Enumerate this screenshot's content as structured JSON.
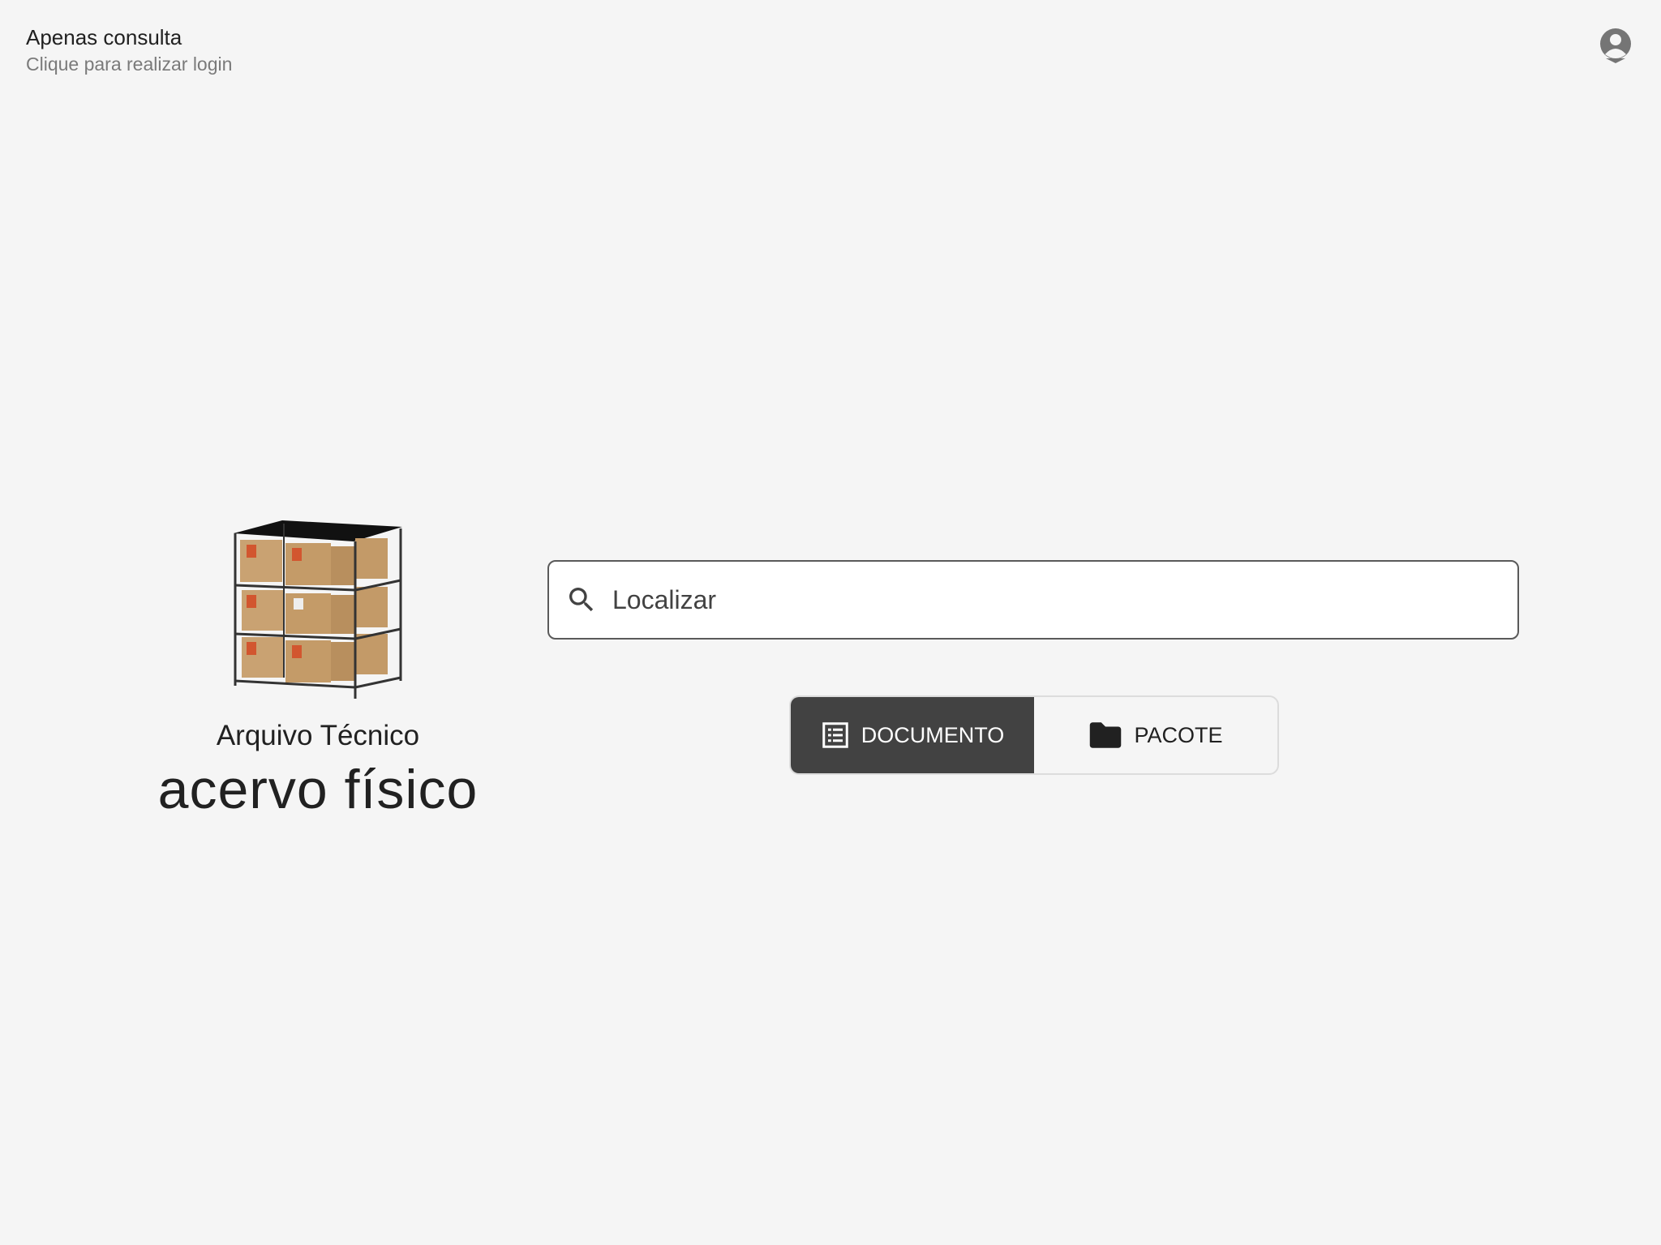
{
  "header": {
    "login_title": "Apenas consulta",
    "login_subtitle": "Clique para realizar login",
    "account_icon": "account-circle-icon"
  },
  "brand": {
    "subtitle": "Arquivo Técnico",
    "title": "acervo físico",
    "image": "storage-shelf-illustration"
  },
  "search": {
    "placeholder": "Localizar",
    "value": "",
    "icon": "search-icon"
  },
  "toggle": {
    "options": [
      {
        "label": "DOCUMENTO",
        "icon": "list-document-icon",
        "selected": true
      },
      {
        "label": "PACOTE",
        "icon": "folder-icon",
        "selected": false
      }
    ],
    "active_bg": "#424242",
    "active_fg": "#ffffff"
  },
  "colors": {
    "background": "#f5f5f5",
    "text": "#212121",
    "muted": "#7a7a7a"
  }
}
